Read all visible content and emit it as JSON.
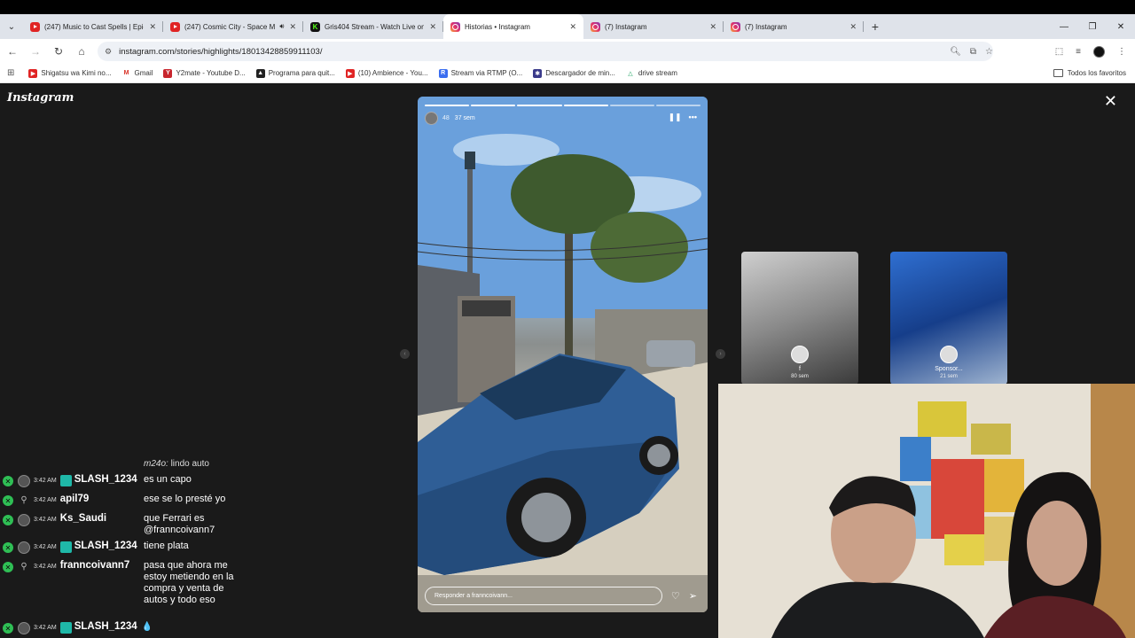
{
  "tabs": [
    {
      "title": "(247) Music to Cast Spells | Epic",
      "icon": "youtube",
      "active": false,
      "audio": false
    },
    {
      "title": "(247) Cosmic City - Space M",
      "icon": "youtube",
      "active": false,
      "audio": true
    },
    {
      "title": "Gris404 Stream - Watch Live on",
      "icon": "kick",
      "active": false,
      "audio": false
    },
    {
      "title": "Historias • Instagram",
      "icon": "instagram",
      "active": true,
      "audio": false
    },
    {
      "title": "(7) Instagram",
      "icon": "instagram",
      "active": false,
      "audio": false
    },
    {
      "title": "(7) Instagram",
      "icon": "instagram",
      "active": false,
      "audio": false
    }
  ],
  "address": {
    "url": "instagram.com/stories/highlights/18013428859911103/"
  },
  "bookmarks": [
    {
      "label": "Shigatsu wa Kimi no...",
      "icon": "youtube"
    },
    {
      "label": "Gmail",
      "icon": "gmail"
    },
    {
      "label": "Y2mate - Youtube D...",
      "icon": "y2mate"
    },
    {
      "label": "Programa para quit...",
      "icon": "triangle"
    },
    {
      "label": "(10) Ambience - You...",
      "icon": "youtube"
    },
    {
      "label": "Stream via RTMP (O...",
      "icon": "r"
    },
    {
      "label": "Descargador de min...",
      "icon": "figure"
    },
    {
      "label": "drive stream",
      "icon": "drive"
    }
  ],
  "bookmarks_folder": "Todos los favoritos",
  "instagram": {
    "logo": "Instagram",
    "story": {
      "user": "48",
      "time": "37 sem",
      "segments": 6,
      "done_segments": 4,
      "reply_placeholder": "Responder a franncoivann..."
    },
    "previews": [
      {
        "name": "f",
        "time": "80 sem"
      },
      {
        "name": "Sponsor...",
        "time": "21 sem"
      }
    ]
  },
  "chat": {
    "partial": {
      "user": "m24o:",
      "msg": "lindo auto"
    },
    "messages": [
      {
        "time": "3:42 AM",
        "user": "SLASH_1234",
        "msg": "es un capo",
        "vip": true,
        "pfp": true
      },
      {
        "time": "3:42 AM",
        "user": "apil79",
        "msg": "ese se lo presté yo",
        "vip": false,
        "pfp": false
      },
      {
        "time": "3:42 AM",
        "user": "Ks_Saudi",
        "msg": "que Ferrari es @franncoivann7",
        "vip": false,
        "pfp": true
      },
      {
        "time": "3:42 AM",
        "user": "SLASH_1234",
        "msg": "tiene plata",
        "vip": true,
        "pfp": true
      },
      {
        "time": "3:42 AM",
        "user": "franncoivann7",
        "msg": "pasa que ahora me estoy metiendo en la compra y venta de autos y todo eso",
        "vip": false,
        "pfp": false
      },
      {
        "time": "3:42 AM",
        "user": "SLASH_1234",
        "msg": "💧",
        "vip": true,
        "pfp": true
      }
    ]
  },
  "colors": {
    "chrome_tabbar": "#dfe3ea",
    "page_bg": "#1a1a1a",
    "mod_badge": "#2fbf55",
    "vip_badge": "#1fb8a8"
  }
}
